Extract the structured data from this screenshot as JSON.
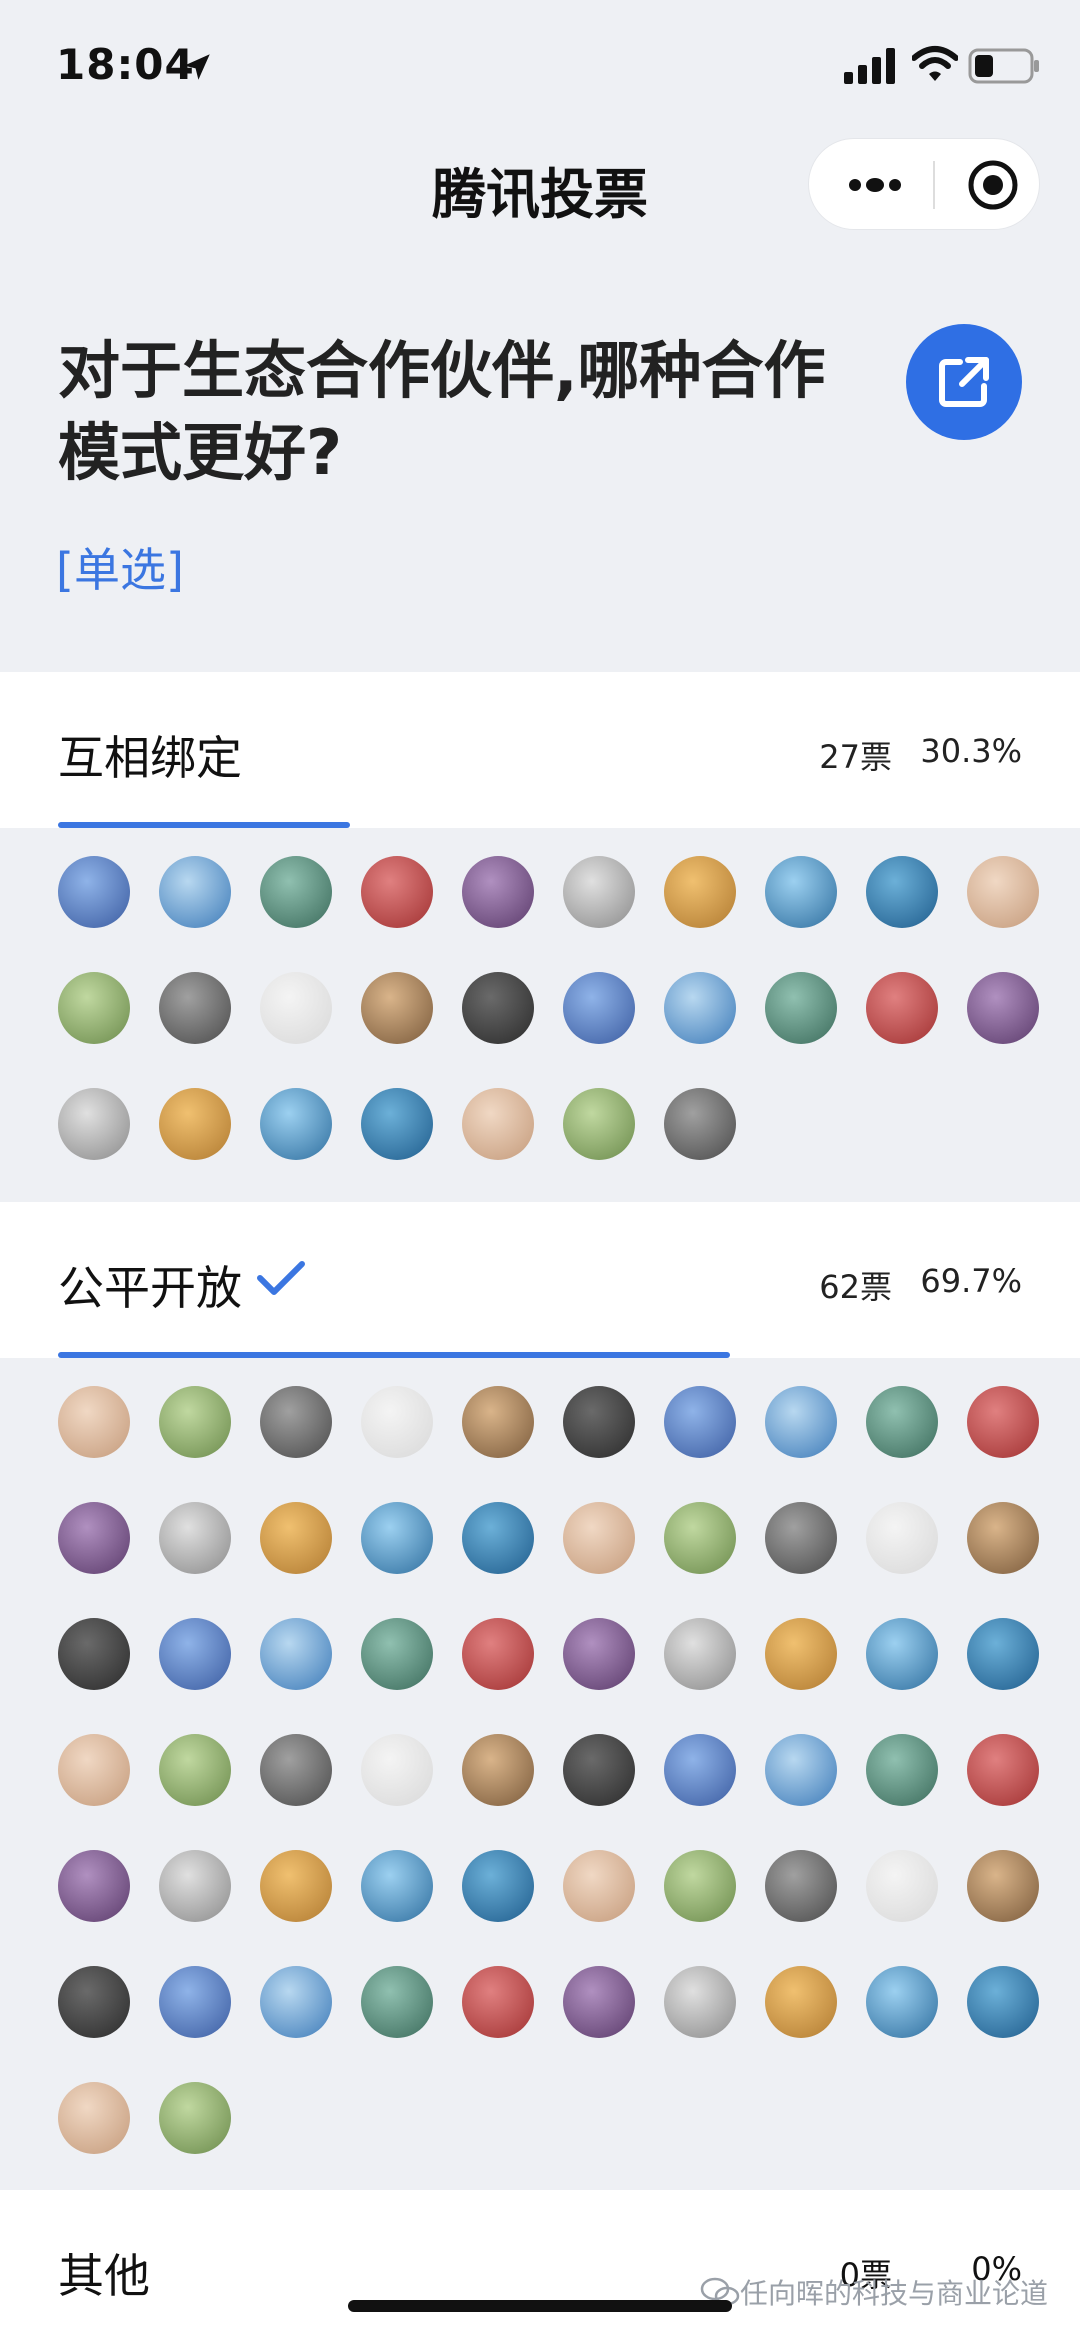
{
  "status_bar": {
    "time": "18:04"
  },
  "nav": {
    "title": "腾讯投票"
  },
  "question": {
    "title": "对于生态合作伙伴,哪种合作模式更好?",
    "type_label": "[单选]"
  },
  "options": [
    {
      "label": "互相绑定",
      "votes": "27票",
      "percent": "30.3%",
      "share": 0.303,
      "voter_count": 27
    },
    {
      "label": "公平开放",
      "votes": "62票",
      "percent": "69.7%",
      "share": 0.697,
      "voter_count": 62,
      "selected": true
    }
  ],
  "footer_option": {
    "label": "其他",
    "votes": "0票",
    "percent": "0%"
  },
  "watermark": "任向晖的科技与商业论道",
  "colors": {
    "accent": "#3b76e1",
    "share_button": "#2f6fe4",
    "background": "#eef0f4"
  },
  "icons": {
    "location": "location-arrow-icon",
    "signal": "cellular-signal-icon",
    "wifi": "wifi-icon",
    "battery": "battery-icon",
    "more": "more-dots-icon",
    "close": "target-close-icon",
    "share": "external-link-icon",
    "check": "checkmark-icon",
    "watermark": "wechat-icon"
  }
}
